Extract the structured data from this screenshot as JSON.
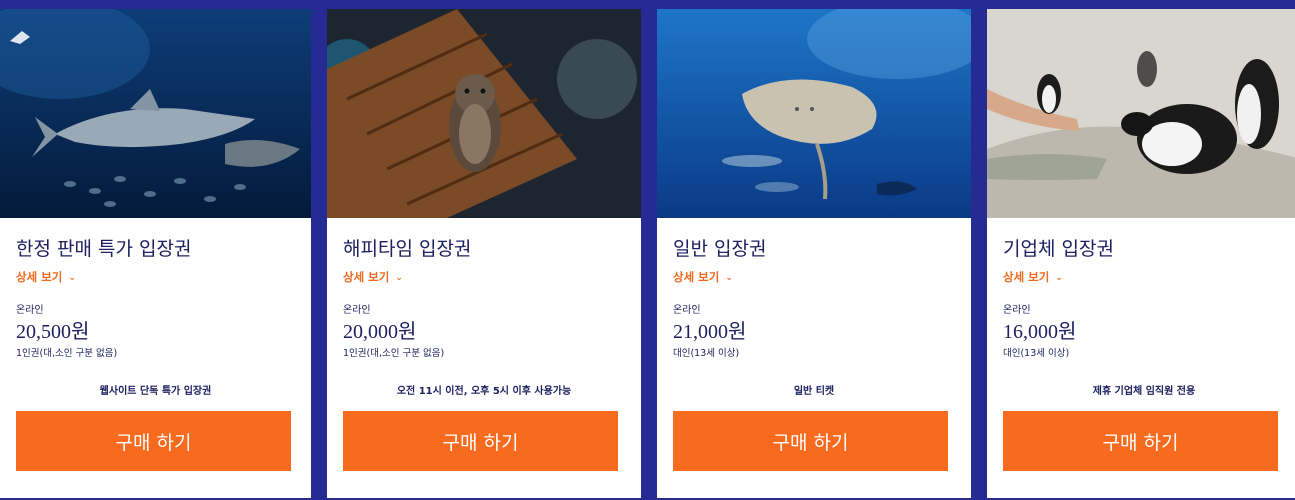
{
  "cards": [
    {
      "title": "한정 판매 특가 입장권",
      "detail": "상세 보기",
      "channel": "온라인",
      "price": "20,500원",
      "condition": "1인권(대,소인 구분 없음)",
      "note": "웹사이트 단독 특가 입장권",
      "buy": "구매 하기"
    },
    {
      "title": "해피타임 입장권",
      "detail": "상세 보기",
      "channel": "온라인",
      "price": "20,000원",
      "condition": "1인권(대,소인 구분 없음)",
      "note": "오전 11시 이전, 오후 5시 이후 사용가능",
      "buy": "구매 하기"
    },
    {
      "title": "일반 입장권",
      "detail": "상세 보기",
      "channel": "온라인",
      "price": "21,000원",
      "condition": "대인(13세 이상)",
      "note": "일반 티켓",
      "buy": "구매 하기"
    },
    {
      "title": "기업체 입장권",
      "detail": "상세 보기",
      "channel": "온라인",
      "price": "16,000원",
      "condition": "대인(13세 이상)",
      "note": "제휴 기업체 임직원 전용",
      "buy": "구매 하기"
    }
  ],
  "colors": {
    "background": "#262a93",
    "accent": "#f86a1d",
    "text": "#1d2160"
  }
}
